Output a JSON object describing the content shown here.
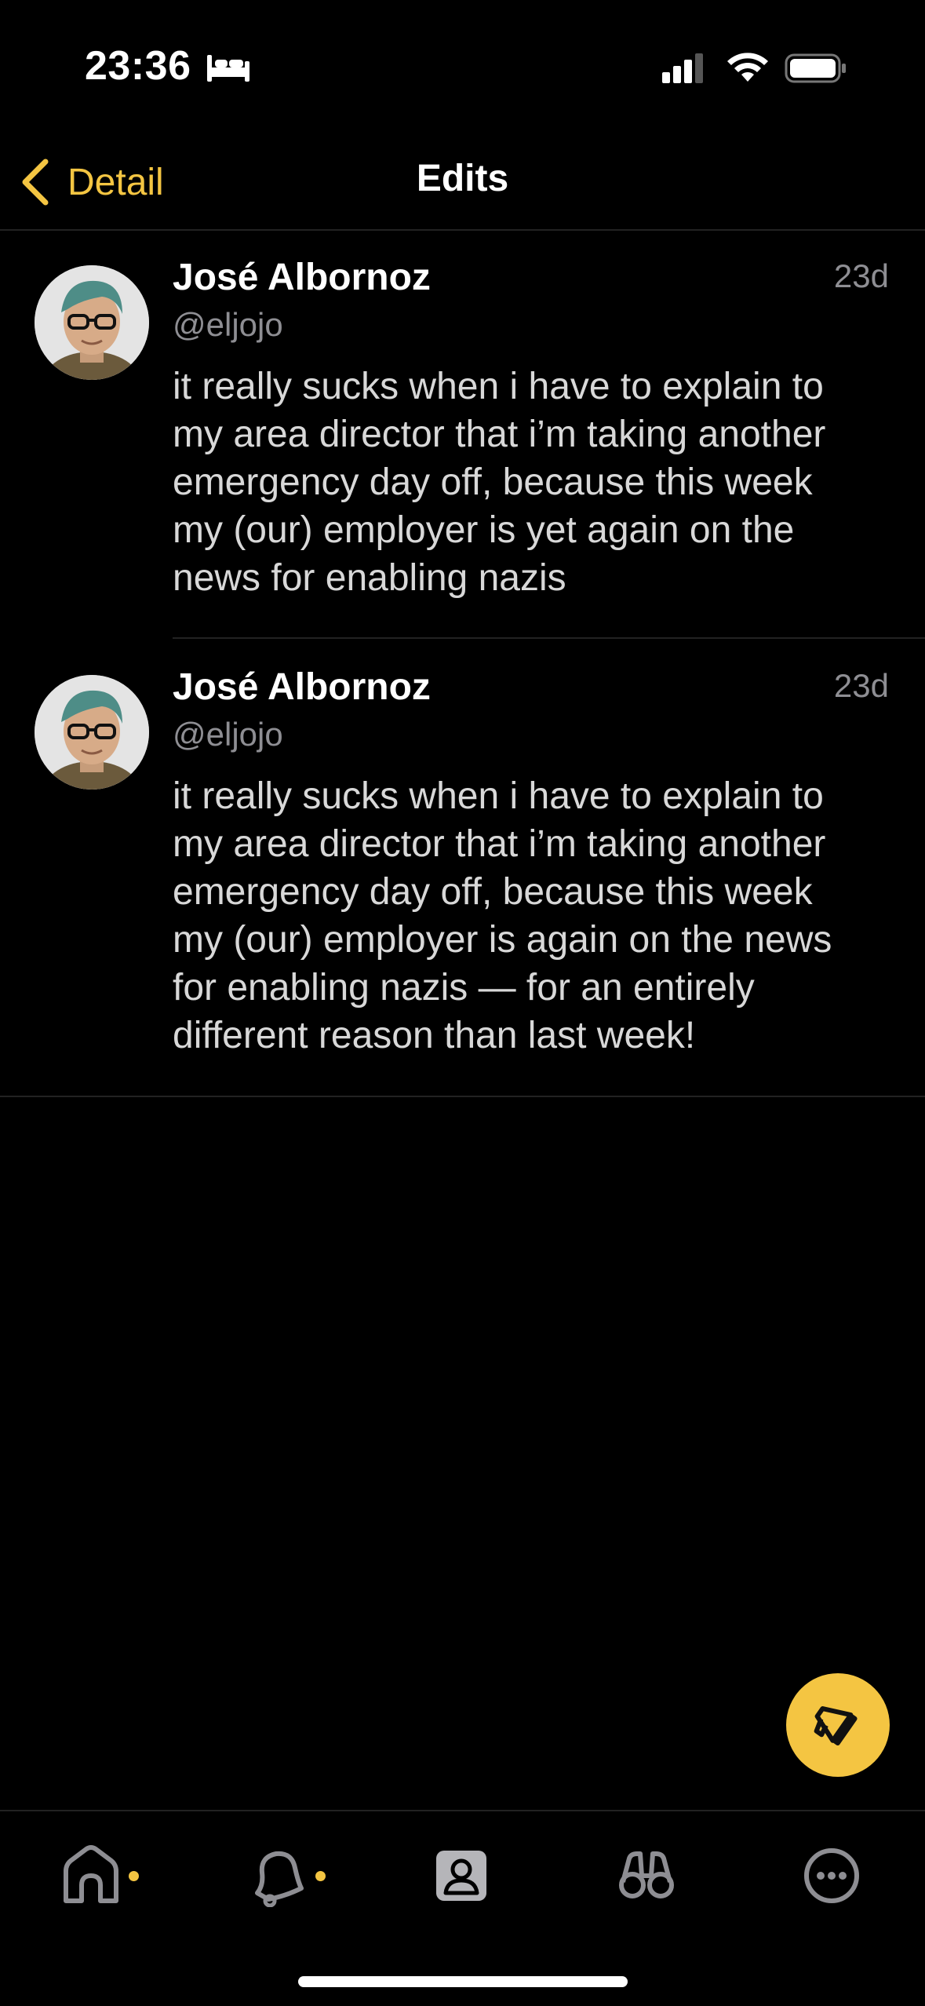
{
  "status_bar": {
    "time": "23:36",
    "icons": [
      "bed-icon",
      "signal-icon",
      "wifi-icon",
      "battery-icon"
    ]
  },
  "nav": {
    "back_label": "Detail",
    "title": "Edits"
  },
  "posts": [
    {
      "author": "José Albornoz",
      "handle": "@eljojo",
      "time": "23d",
      "lines": [
        "it really sucks when i have to explain to",
        "my area director that i’m taking another",
        "emergency day off, because this week",
        "my (our) employer is yet again on the",
        "news for enabling nazis"
      ]
    },
    {
      "author": "José Albornoz",
      "handle": "@eljojo",
      "time": "23d",
      "lines": [
        "it really sucks when i have to explain to",
        "my area director that i’m taking another",
        "emergency day off, because this week",
        "my (our) employer is again on the news",
        "for enabling nazis — for an entirely",
        "different reason than last week!"
      ]
    }
  ],
  "fab": {
    "icon": "megaphone-icon"
  },
  "tabs": [
    {
      "icon": "home-icon",
      "has_dot": true
    },
    {
      "icon": "notifications-icon",
      "has_dot": true
    },
    {
      "icon": "profile-icon",
      "has_dot": false
    },
    {
      "icon": "explore-icon",
      "has_dot": false
    },
    {
      "icon": "more-icon",
      "has_dot": false
    }
  ],
  "colors": {
    "accent": "#F4C542",
    "background": "#000000",
    "secondary_text": "#8e8e93",
    "body_text": "#d8d8d8"
  }
}
